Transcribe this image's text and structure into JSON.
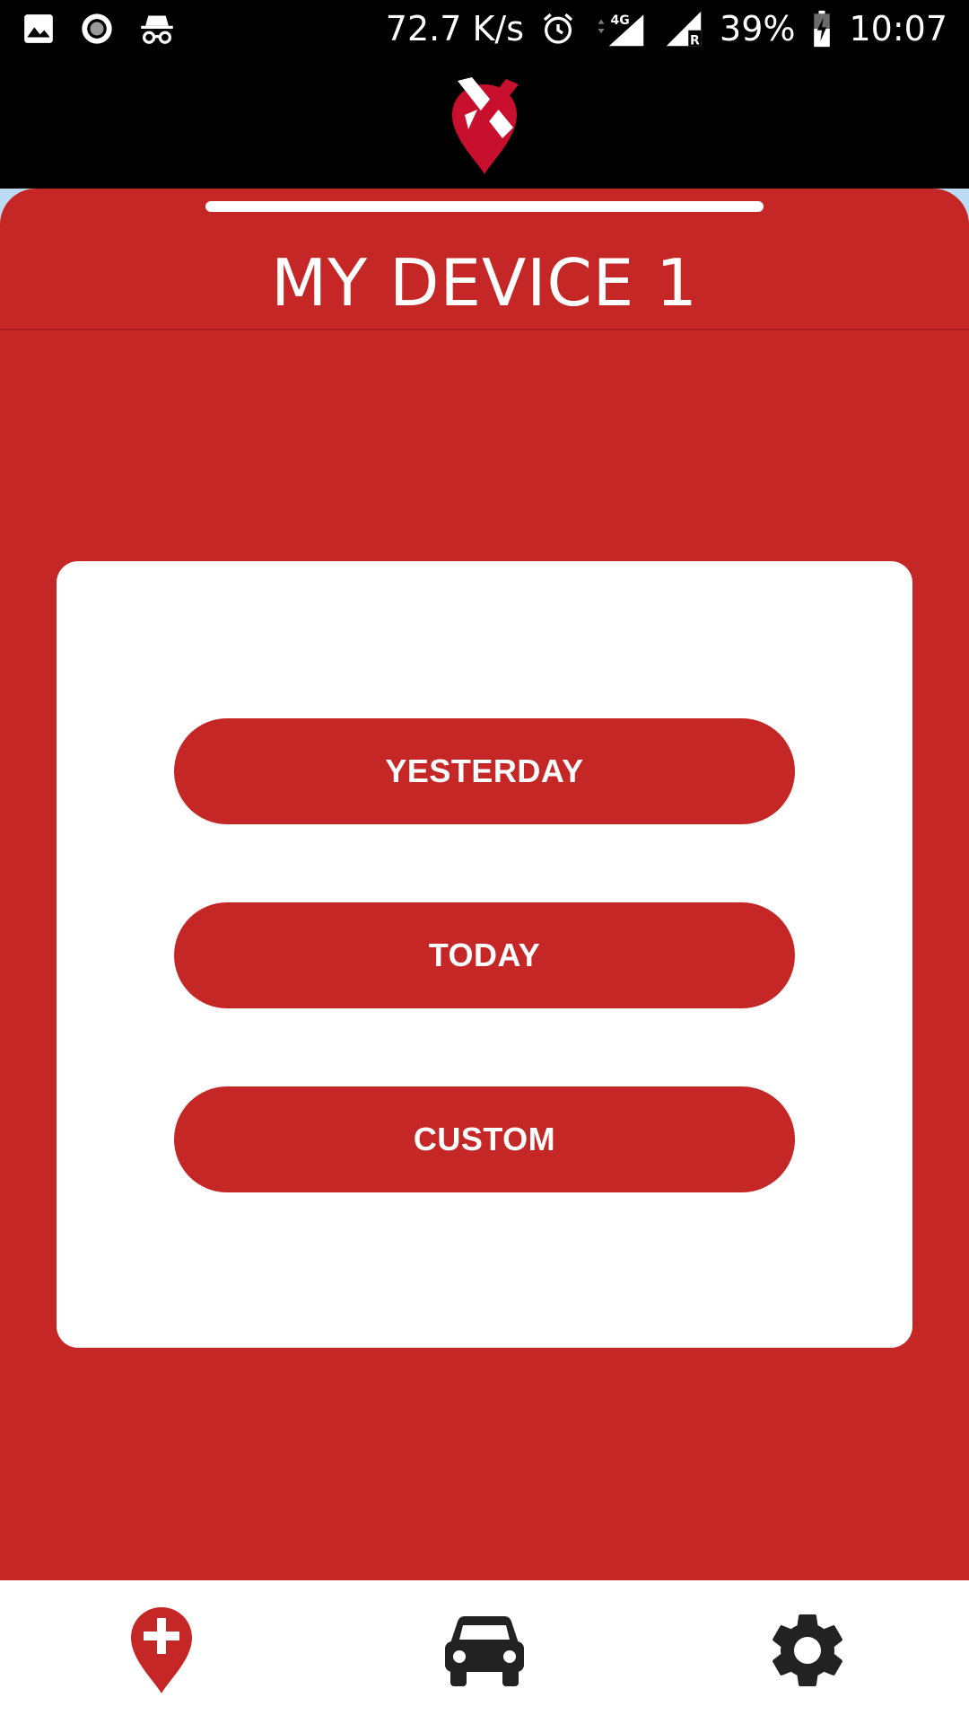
{
  "status_bar": {
    "left_icons": [
      "image-icon",
      "record-icon",
      "incognito-icon"
    ],
    "network_speed": "72.7 K/s",
    "signal_label": "4G",
    "roaming_label": "R",
    "battery_percent": "39%",
    "time": "10:07"
  },
  "header": {
    "logo_icon": "location-pin-logo"
  },
  "device": {
    "title": "MY DEVICE 1"
  },
  "options": {
    "yesterday_label": "YESTERDAY",
    "today_label": "TODAY",
    "custom_label": "CUSTOM"
  },
  "bottom_nav": {
    "items": [
      {
        "icon": "add-location-icon"
      },
      {
        "icon": "car-icon"
      },
      {
        "icon": "gear-icon"
      }
    ]
  },
  "colors": {
    "brand_red": "#c52727",
    "status_bg": "#000000",
    "card_bg": "#ffffff",
    "icon_dark": "#222222"
  }
}
